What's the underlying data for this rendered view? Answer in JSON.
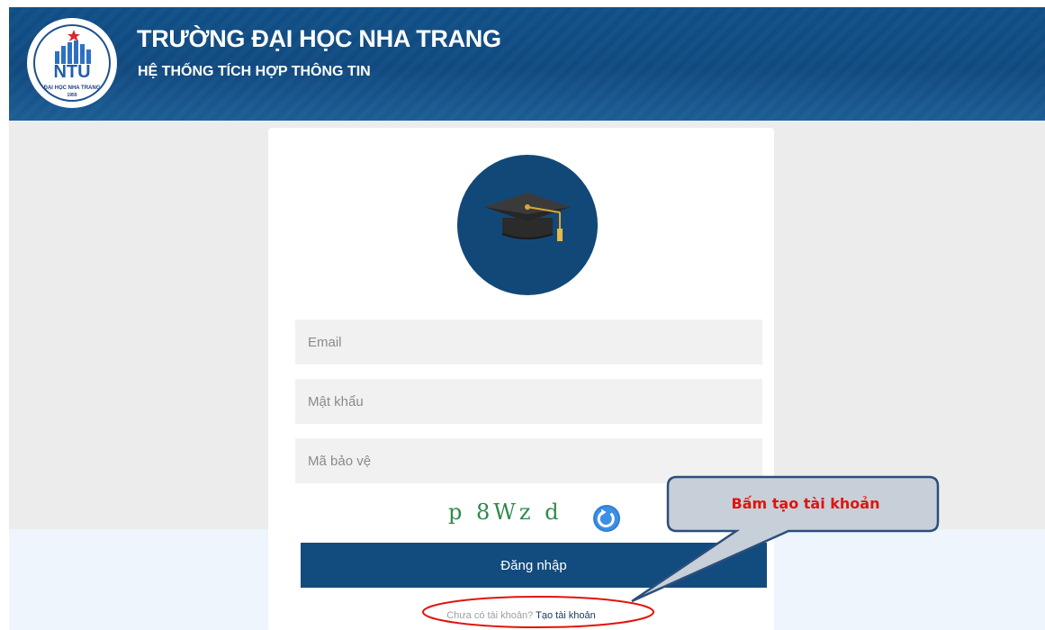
{
  "header": {
    "title": "TRƯỜNG ĐẠI HỌC NHA TRANG",
    "subtitle": "HỆ THỐNG TÍCH HỢP THÔNG TIN",
    "logo": {
      "abbr": "NTU",
      "name": "ĐẠI HỌC NHA TRANG",
      "year": "1959"
    }
  },
  "login": {
    "avatar_icon": "graduation-cap-icon",
    "email_placeholder": "Email",
    "password_placeholder": "Mật khẩu",
    "captcha_placeholder": "Mã bảo vệ",
    "captcha_text": "p 8Wz d",
    "refresh_icon": "refresh-icon",
    "submit_label": "Đăng nhập",
    "no_account_text": "Chưa có tài khoản?",
    "signup_link": "Tạo tài khoản"
  },
  "annotation": {
    "callout_text": "Bấm tạo tài khoản"
  },
  "colors": {
    "header_blue": "#114a80",
    "button_blue": "#124b7e",
    "annotation_red": "#e0140c",
    "callout_gray": "#c7cfd9"
  }
}
